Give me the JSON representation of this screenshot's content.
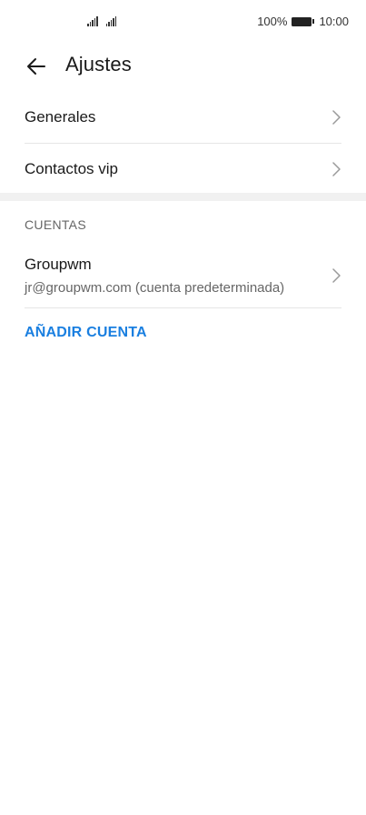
{
  "status_bar": {
    "battery_percent": "100%",
    "time": "10:00",
    "signal_icons": [
      "signal-icon",
      "signal-icon"
    ],
    "battery_icon": "battery-icon"
  },
  "header": {
    "back_icon": "arrow-left-icon",
    "title": "Ajustes"
  },
  "settings": {
    "items": [
      {
        "label": "Generales",
        "icon": "chevron-right-icon"
      },
      {
        "label": "Contactos vip",
        "icon": "chevron-right-icon"
      }
    ]
  },
  "accounts": {
    "section_title": "CUENTAS",
    "items": [
      {
        "name": "Groupwm",
        "subtitle": "jr@groupwm.com (cuenta predeterminada)",
        "icon": "chevron-right-icon"
      }
    ],
    "add_label": "AÑADIR CUENTA"
  },
  "colors": {
    "accent": "#1a7fe0",
    "separator": "#f1f1f1",
    "divider": "#e6e6e6"
  }
}
